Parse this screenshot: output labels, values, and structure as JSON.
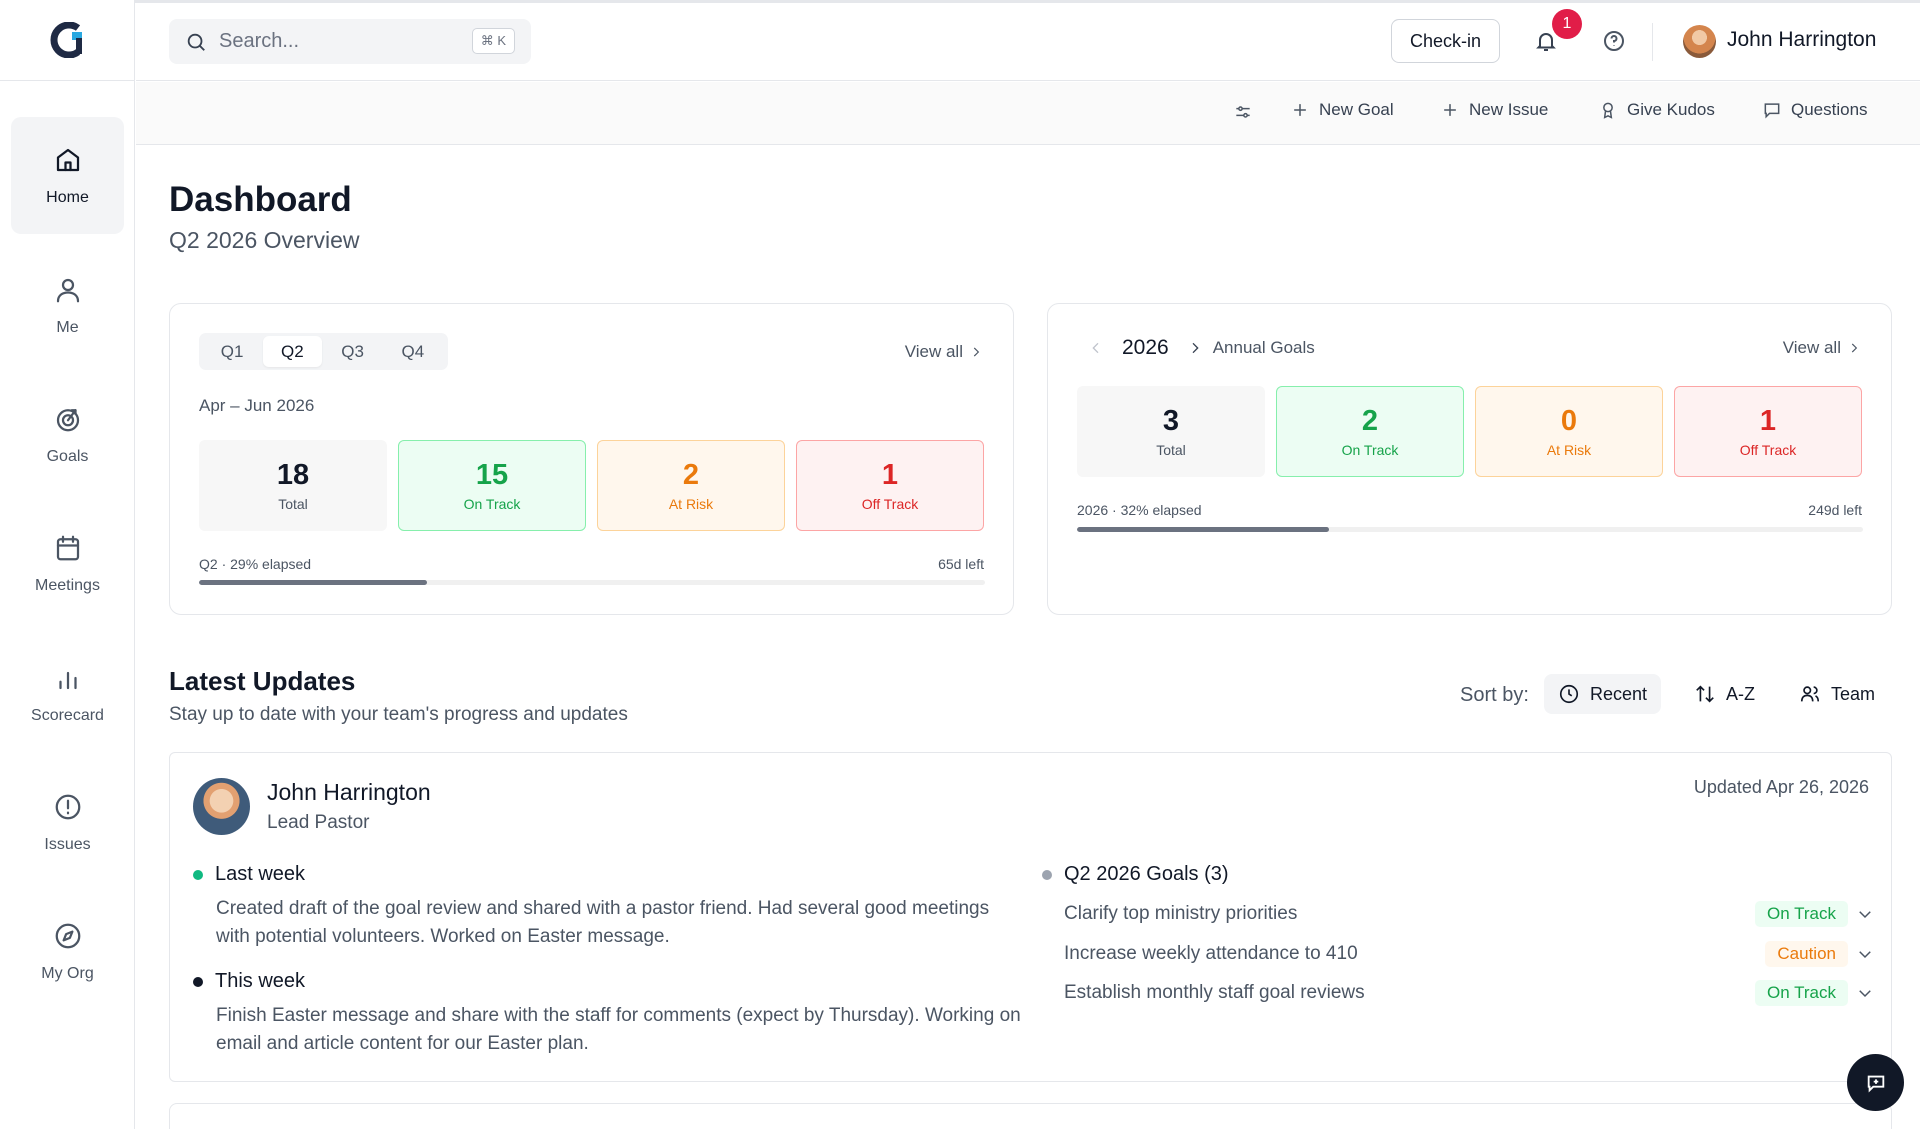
{
  "header": {
    "search_placeholder": "Search...",
    "search_shortcut": "⌘ K",
    "checkin_label": "Check-in",
    "notification_count": "1",
    "user_name": "John Harrington"
  },
  "sidebar": {
    "items": [
      {
        "label": "Home",
        "icon": "home-icon"
      },
      {
        "label": "Me",
        "icon": "user-icon"
      },
      {
        "label": "Goals",
        "icon": "target-icon"
      },
      {
        "label": "Meetings",
        "icon": "calendar-icon"
      },
      {
        "label": "Scorecard",
        "icon": "bar-chart-icon"
      },
      {
        "label": "Issues",
        "icon": "alert-circle-icon"
      },
      {
        "label": "My Org",
        "icon": "compass-icon"
      }
    ]
  },
  "actions": {
    "new_goal": "New Goal",
    "new_issue": "New Issue",
    "give_kudos": "Give Kudos",
    "questions": "Questions"
  },
  "page": {
    "title": "Dashboard",
    "subtitle": "Q2 2026 Overview"
  },
  "quarter_card": {
    "tabs": [
      "Q1",
      "Q2",
      "Q3",
      "Q4"
    ],
    "active_tab": "Q2",
    "view_all": "View all",
    "range": "Apr – Jun 2026",
    "stats": {
      "total": {
        "value": "18",
        "label": "Total"
      },
      "on_track": {
        "value": "15",
        "label": "On Track"
      },
      "at_risk": {
        "value": "2",
        "label": "At Risk"
      },
      "off_track": {
        "value": "1",
        "label": "Off Track"
      }
    },
    "progress_label": "Q2 · 29% elapsed",
    "progress_fraction": 0.29,
    "days_left": "65d left"
  },
  "annual_card": {
    "year": "2026",
    "label": "Annual Goals",
    "view_all": "View all",
    "stats": {
      "total": {
        "value": "3",
        "label": "Total"
      },
      "on_track": {
        "value": "2",
        "label": "On Track"
      },
      "at_risk": {
        "value": "0",
        "label": "At Risk"
      },
      "off_track": {
        "value": "1",
        "label": "Off Track"
      }
    },
    "progress_label": "2026 · 32% elapsed",
    "progress_fraction": 0.32,
    "days_left": "249d left"
  },
  "updates": {
    "title": "Latest Updates",
    "subtitle": "Stay up to date with your team's progress and updates",
    "sort_label": "Sort by:",
    "sort_options": [
      "Recent",
      "A-Z",
      "Team"
    ],
    "active_sort": "Recent",
    "entry": {
      "name": "John Harrington",
      "role": "Lead Pastor",
      "updated": "Updated Apr 26, 2026",
      "last_week_heading": "Last week",
      "last_week_text": "Created draft of the goal review and shared with a pastor friend. Had several good meetings with potential volunteers. Worked on Easter message.",
      "this_week_heading": "This week",
      "this_week_text": "Finish Easter message and share with the staff for comments (expect by Thursday). Working on email and article content for our Easter plan.",
      "goals_heading": "Q2 2026 Goals (3)",
      "goals": [
        {
          "text": "Clarify top ministry priorities",
          "status": "On Track"
        },
        {
          "text": "Increase weekly attendance to 410",
          "status": "Caution"
        },
        {
          "text": "Establish monthly staff goal reviews",
          "status": "On Track"
        }
      ]
    }
  },
  "colors": {
    "on_track": "#16a34a",
    "at_risk": "#ea7a0c",
    "off_track": "#dc2626",
    "badge": "#e11d48",
    "brand_dark": "#1f2a44",
    "brand_accent": "#2aa8e0"
  }
}
